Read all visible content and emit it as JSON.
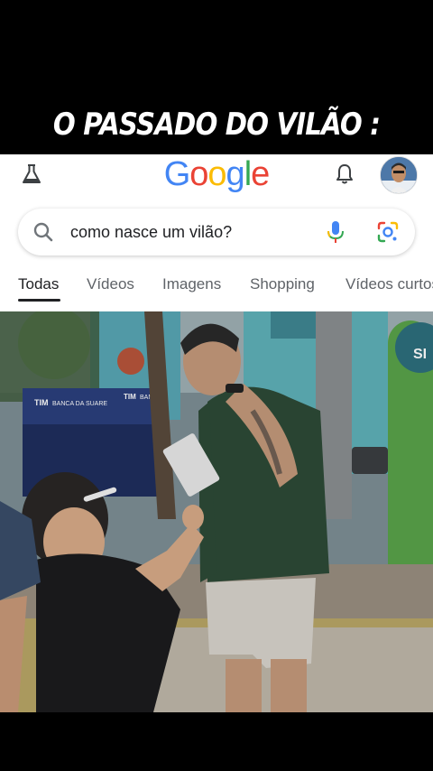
{
  "overlay": {
    "title": "O PASSADO DO VILÃO :"
  },
  "header": {
    "logo_letters": [
      {
        "char": "G",
        "color": "#4285F4"
      },
      {
        "char": "o",
        "color": "#EA4335"
      },
      {
        "char": "o",
        "color": "#FBBC05"
      },
      {
        "char": "g",
        "color": "#4285F4"
      },
      {
        "char": "l",
        "color": "#34A853"
      },
      {
        "char": "e",
        "color": "#EA4335"
      }
    ],
    "icons": [
      "labs-flask-icon",
      "bell-icon",
      "avatar"
    ]
  },
  "search": {
    "query": "como nasce um vilão?",
    "icons": [
      "search-icon",
      "mic-icon",
      "google-lens-icon"
    ]
  },
  "tabs": [
    {
      "label": "Todas",
      "active": true
    },
    {
      "label": "Vídeos",
      "active": false
    },
    {
      "label": "Imagens",
      "active": false
    },
    {
      "label": "Shopping",
      "active": false
    },
    {
      "label": "Vídeos curtos",
      "active": false
    }
  ],
  "photo_signs": {
    "tim_sign_1": "TIM",
    "tim_sign_2": "TIM",
    "banca_sign_1": "BANCA DA SUARE",
    "banca_sign_2": "BANCA",
    "right_sign": "SI"
  },
  "colors": {
    "google_blue": "#4285F4",
    "google_red": "#EA4335",
    "google_yellow": "#FBBC05",
    "google_green": "#34A853"
  }
}
